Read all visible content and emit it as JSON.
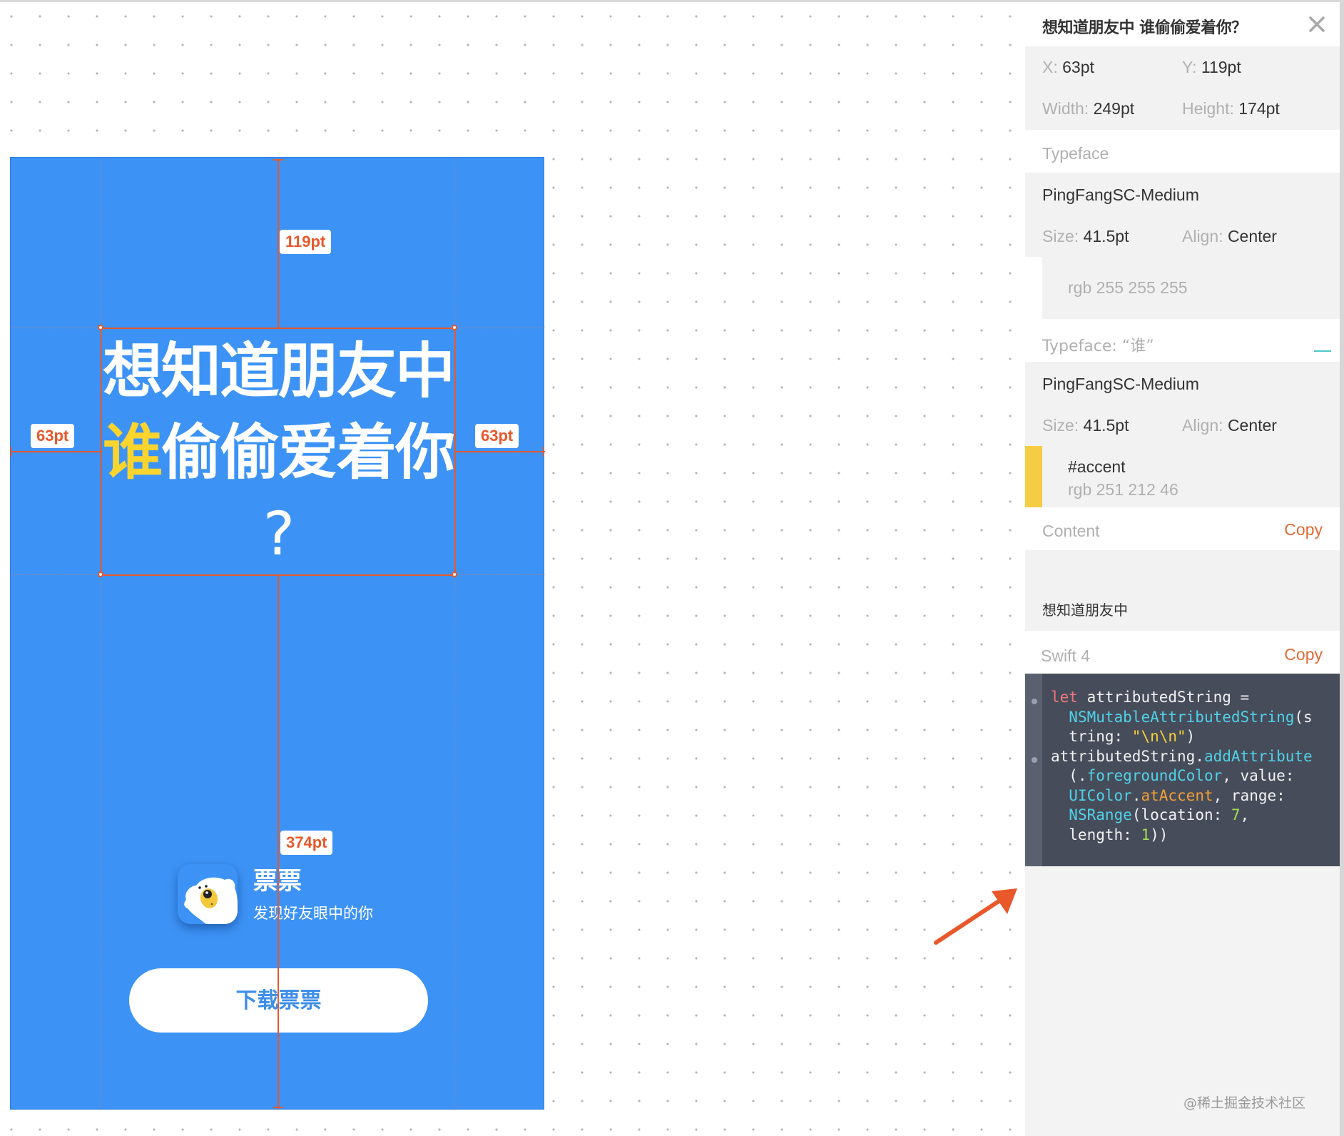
{
  "artboard": {
    "headline_line1": "想知道朋友中",
    "headline_accent": "谁",
    "headline_line2_rest": "偷偷爱着你",
    "headline_line3": "?",
    "background_color": "#3d93f5",
    "accent_color": "#fbd42e",
    "measurements": {
      "top": "119pt",
      "left": "63pt",
      "right": "63pt",
      "bottom": "374pt"
    },
    "app": {
      "name": "票票",
      "tagline": "发现好友眼中的你",
      "icon": "polar-bear-icon"
    },
    "download_button_label": "下载票票"
  },
  "inspector": {
    "title": "想知道朋友中 谁偷偷爱着你？",
    "close_icon": "close-icon",
    "position": {
      "x_label": "X:",
      "x_value": "63pt",
      "y_label": "Y:",
      "y_value": "119pt",
      "width_label": "Width:",
      "width_value": "249pt",
      "height_label": "Height:",
      "height_value": "174pt"
    },
    "typeface_section": {
      "heading": "Typeface",
      "font": "PingFangSC-Medium",
      "size_label": "Size:",
      "size_value": "41.5pt",
      "align_label": "Align:",
      "align_value": "Center",
      "color_rgb": "rgb 255 255 255",
      "color_hex": "#ffffff"
    },
    "typeface_accent_section": {
      "heading": "Typeface: “谁”",
      "font": "PingFangSC-Medium",
      "size_label": "Size:",
      "size_value": "41.5pt",
      "align_label": "Align:",
      "align_value": "Center",
      "color_name": "#accent",
      "color_rgb": "rgb 251 212 46",
      "color_hex": "#fbd42e"
    },
    "content_section": {
      "heading": "Content",
      "copy_label": "Copy",
      "lines": [
        "想知道朋友中",
        "谁偷偷爱着你",
        "?"
      ]
    },
    "swift_section": {
      "heading": "Swift 4",
      "copy_label": "Copy",
      "code_lines": [
        "let attributedString =",
        "  NSMutableAttributedString(s",
        "  tring: \"\\n\\n\")",
        "attributedString.addAttribute",
        "  (.foregroundColor, value:",
        "  UIColor.atAccent, range:",
        "  NSRange(location: 7,",
        "  length: 1))"
      ]
    }
  },
  "annotation": {
    "arrow_color": "#e8582a"
  },
  "watermark": "@稀土掘金技术社区"
}
